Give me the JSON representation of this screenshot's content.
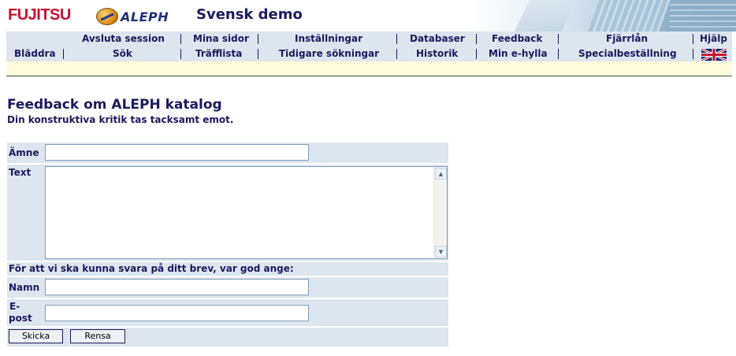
{
  "header": {
    "fujitsu_logo": "FUJITSU",
    "aleph_logo": "ALEPH",
    "site_title": "Svensk demo"
  },
  "nav": {
    "row1": [
      "Avsluta session",
      "Mina sidor",
      "Inställningar",
      "Databaser",
      "Feedback",
      "Fjärrlån",
      "Hjälp"
    ],
    "row2": [
      "Bläddra",
      "Sök",
      "Träfflista",
      "Tidigare sökningar",
      "Historik",
      "Min e-hylla",
      "Specialbeställning"
    ],
    "language_icon": "uk-flag-icon"
  },
  "page": {
    "title": "Feedback om ALEPH katalog",
    "subtitle": "Din konstruktiva kritik tas tacksamt emot."
  },
  "form": {
    "subject_label": "Ämne",
    "subject_value": "",
    "text_label": "Text",
    "text_value": "",
    "contact_note": "För att vi ska kunna svara på ditt brev, var god ange:",
    "name_label": "Namn",
    "name_value": "",
    "email_label_line1": "E-",
    "email_label_line2": "post",
    "email_value": "",
    "submit_label": "Skicka",
    "reset_label": "Rensa"
  },
  "colors": {
    "nav_background": "#dde5ee",
    "text_navy": "#1a1a5e",
    "cream_bar": "#fffbdc",
    "fujitsu_red": "#c8102e"
  }
}
